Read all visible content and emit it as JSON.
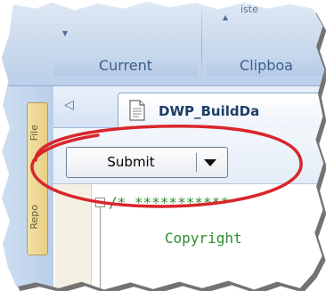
{
  "ribbon": {
    "top_text": "iste",
    "groups": [
      {
        "label": "Current"
      },
      {
        "label": "Clipboa"
      }
    ]
  },
  "side_panel": {
    "tabs": [
      {
        "label": "File"
      },
      {
        "label": "Repo"
      }
    ]
  },
  "document": {
    "tab_title": "DWP_BuildDa",
    "nav_arrow": "◁"
  },
  "toolbar": {
    "submit_label": "Submit",
    "dropdown_arrow": "▼"
  },
  "editor": {
    "lines": [
      "/* ***********",
      "   Copyright"
    ]
  },
  "colors": {
    "annotation": "#d9262b",
    "code_comment": "#2e8b2e",
    "ribbon_bg": "#cad9ec"
  }
}
